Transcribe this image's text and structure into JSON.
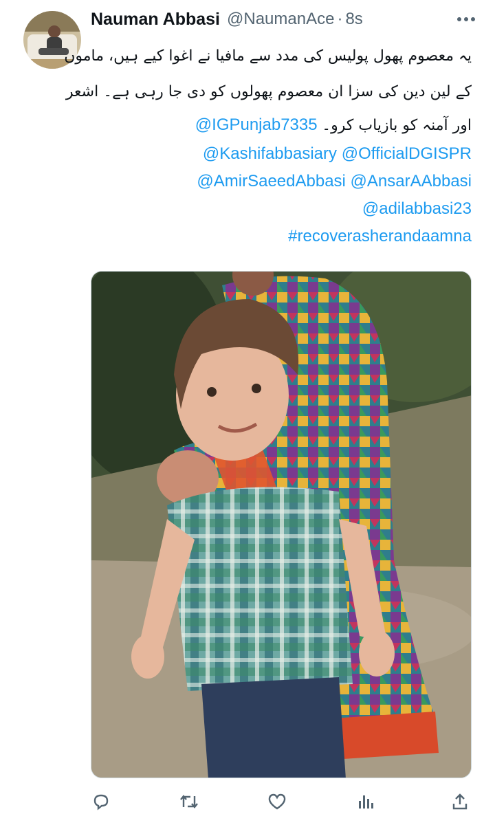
{
  "tweet": {
    "display_name": "Nauman Abbasi",
    "handle": "@NaumanAce",
    "separator": "·",
    "time": "8s",
    "lines": [
      "یہ معصوم پھول پولیس کی مدد سے مافیا نے اغوا کیے ہیں، ماموں",
      "کے لین دین کی سزا ان معصوم پھولوں کو دی جا رہی ہے۔ اشعر",
      "اور آمنہ کو بازیاب کرو۔"
    ],
    "mentions": [
      "@IGPunjab7335",
      "@Kashifabbasiary",
      "@OfficialDGISPR",
      "@AmirSaeedAbbasi",
      "@AnsarAAbbasi",
      "@adilabbasi23"
    ],
    "hashtag": "#recoverasherandaamna"
  },
  "colors": {
    "link": "#1d9bf0",
    "text": "#0f1419",
    "muted": "#536471"
  },
  "icons": [
    "more-icon",
    "reply-icon",
    "retweet-icon",
    "like-icon",
    "views-icon",
    "share-icon"
  ]
}
